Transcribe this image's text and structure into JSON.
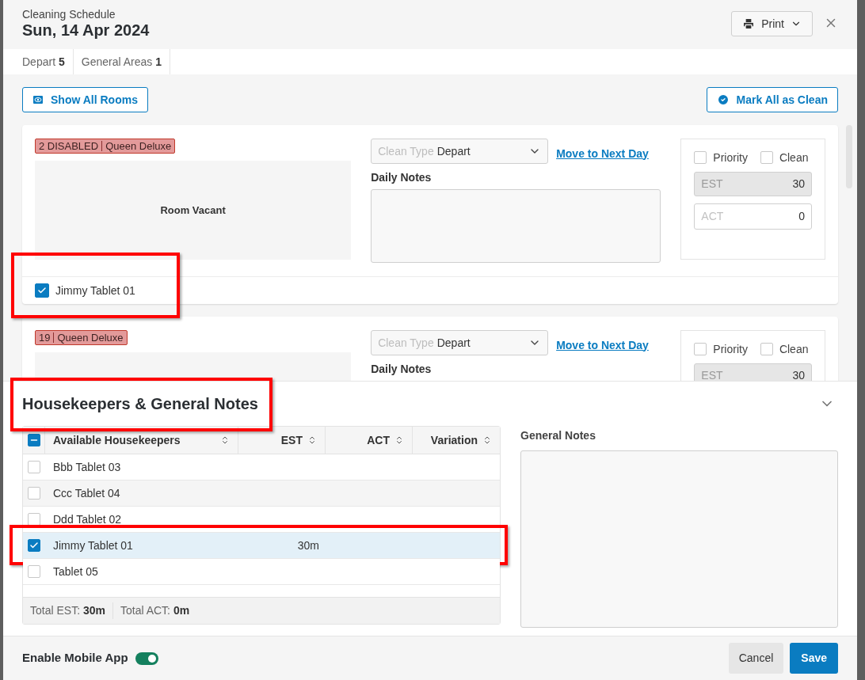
{
  "header": {
    "subtitle": "Cleaning Schedule",
    "title": "Sun, 14 Apr 2024",
    "print_button": "Print"
  },
  "tabs": [
    {
      "label": "Depart",
      "count": "5",
      "selected": false
    },
    {
      "label": "General Areas",
      "count": "1",
      "selected": false
    }
  ],
  "toolbar": {
    "show_all_button": "Show All Rooms",
    "mark_clean_button": "Mark All as Clean"
  },
  "rooms": [
    {
      "number": "2 DISABLED",
      "type": "Queen Deluxe",
      "status": "Room Vacant",
      "clean_type_placeholder": "Clean Type",
      "clean_type": "Depart",
      "move_link": "Move to Next Day",
      "notes_label": "Daily Notes",
      "priority": {
        "label": "Priority",
        "checked": false
      },
      "clean": {
        "label": "Clean",
        "checked": false
      },
      "est": {
        "placeholder": "EST",
        "value": "30"
      },
      "act": {
        "placeholder": "ACT",
        "value": "0"
      },
      "assignee": {
        "name": "Jimmy Tablet 01",
        "checked": true,
        "highlighted": true
      }
    },
    {
      "number": "19",
      "type": "Queen Deluxe",
      "clean_type_placeholder": "Clean Type",
      "clean_type": "Depart",
      "move_link": "Move to Next Day",
      "notes_label": "Daily Notes",
      "priority": {
        "label": "Priority",
        "checked": false
      },
      "clean": {
        "label": "Clean",
        "checked": false
      },
      "est": {
        "placeholder": "EST",
        "value": "30"
      }
    }
  ],
  "section": {
    "title": "Housekeepers & General Notes",
    "highlighted": true,
    "expanded": true
  },
  "table": {
    "select_all_indeterminate": true,
    "columns": [
      "Available Housekeepers",
      "EST",
      "ACT",
      "Variation"
    ],
    "rows": [
      {
        "name": "Bbb Tablet 03",
        "checked": false,
        "selected": false,
        "highlighted": false
      },
      {
        "name": "Ccc Tablet 04",
        "checked": false,
        "selected": false,
        "highlighted": false
      },
      {
        "name": "Ddd Tablet 02",
        "checked": false,
        "selected": false,
        "highlighted": false
      },
      {
        "name": "Jimmy Tablet 01",
        "est": "30m",
        "checked": true,
        "selected": true,
        "highlighted": true
      },
      {
        "name": "Tablet 05",
        "checked": false,
        "selected": false,
        "highlighted": false
      }
    ],
    "totals": [
      "Total EST: **30m**",
      "Total ACT: **0m**"
    ]
  },
  "general_notes": {
    "label": "General Notes"
  },
  "footer": {
    "mobile_label": "Enable Mobile App",
    "mobile_on": true,
    "cancel": "Cancel",
    "save": "Save"
  }
}
